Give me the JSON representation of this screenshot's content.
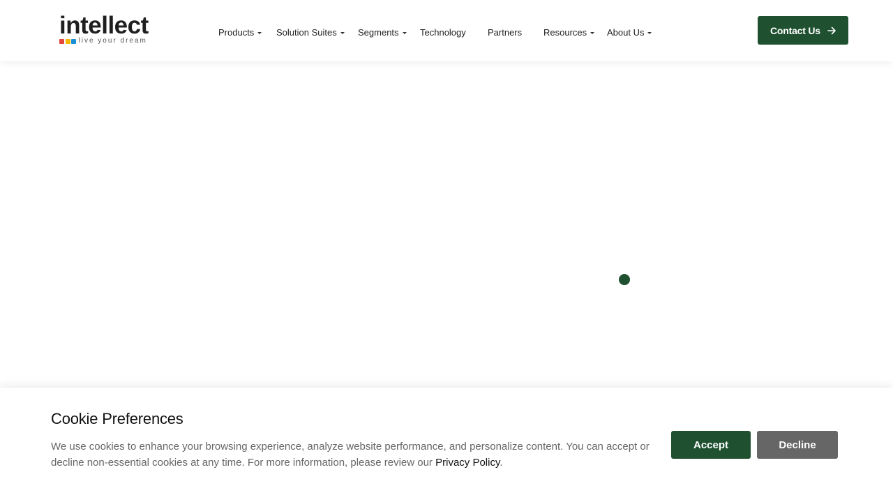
{
  "header": {
    "logo": {
      "word": "intellect",
      "tagline": "live your dream",
      "dot_colors": [
        "#e4463b",
        "#f5b800",
        "#1a8fd6"
      ]
    },
    "nav": [
      {
        "label": "Products",
        "has_dropdown": true
      },
      {
        "label": "Solution Suites",
        "has_dropdown": true
      },
      {
        "label": "Segments",
        "has_dropdown": true
      },
      {
        "label": "Technology",
        "has_dropdown": false
      },
      {
        "label": "Partners",
        "has_dropdown": false
      },
      {
        "label": "Resources",
        "has_dropdown": true
      },
      {
        "label": "About Us",
        "has_dropdown": true
      }
    ],
    "contact_button": {
      "label": "Contact Us",
      "icon": "arrow-right-icon"
    }
  },
  "colors": {
    "brand_green": "#1f5130",
    "decline_gray": "#666666",
    "text_dark": "#222222",
    "text_muted": "#666666"
  },
  "cookie_banner": {
    "title": "Cookie Preferences",
    "text": "We use cookies to enhance your browsing experience, analyze website performance, and personalize content. You can accept or decline non-essential cookies at any time. For more information, please review our ",
    "link_text": "Privacy Policy",
    "text_end": ".",
    "accept_label": "Accept",
    "decline_label": "Decline"
  }
}
